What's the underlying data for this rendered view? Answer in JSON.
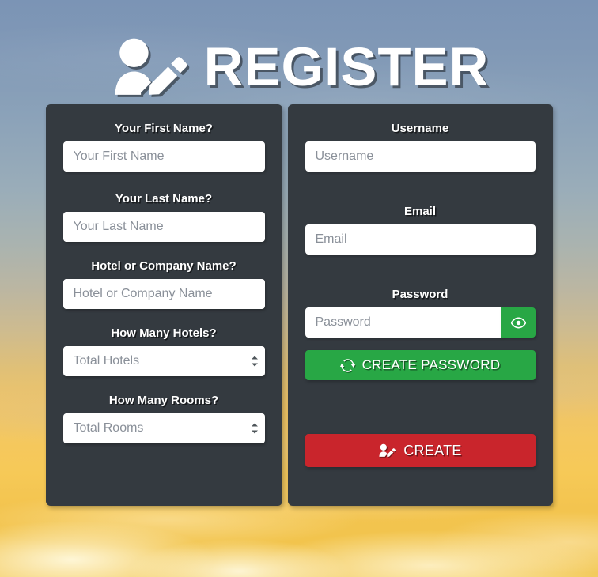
{
  "header": {
    "title": "REGISTER",
    "icon": "user-edit-icon"
  },
  "left_panel": {
    "fields": [
      {
        "label": "Your First Name?",
        "placeholder": "Your First Name",
        "name": "first-name",
        "type": "text"
      },
      {
        "label": "Your Last Name?",
        "placeholder": "Your Last Name",
        "name": "last-name",
        "type": "text"
      },
      {
        "label": "Hotel or Company Name?",
        "placeholder": "Hotel or Company Name",
        "name": "company-name",
        "type": "text"
      },
      {
        "label": "How Many Hotels?",
        "placeholder": "Total Hotels",
        "name": "total-hotels",
        "type": "number"
      },
      {
        "label": "How Many Rooms?",
        "placeholder": "Total Rooms",
        "name": "total-rooms",
        "type": "number"
      }
    ]
  },
  "right_panel": {
    "username": {
      "label": "Username",
      "placeholder": "Username",
      "value": ""
    },
    "email": {
      "label": "Email",
      "placeholder": "Email",
      "value": ""
    },
    "password": {
      "label": "Password",
      "placeholder": "Password",
      "value": "",
      "toggle_icon": "eye-icon"
    },
    "create_password_button": {
      "label": "CREATE PASSWORD",
      "icon": "sync-icon"
    },
    "create_button": {
      "label": "CREATE",
      "icon": "user-edit-icon"
    }
  },
  "colors": {
    "panel_background": "#343a40",
    "success": "#28a745",
    "danger": "#c9252c",
    "input_background": "#ffffff",
    "placeholder_text": "#8a9099",
    "label_text": "#ffffff",
    "sky_top": "#7b94b5",
    "sky_bottom": "#f3c44f"
  }
}
